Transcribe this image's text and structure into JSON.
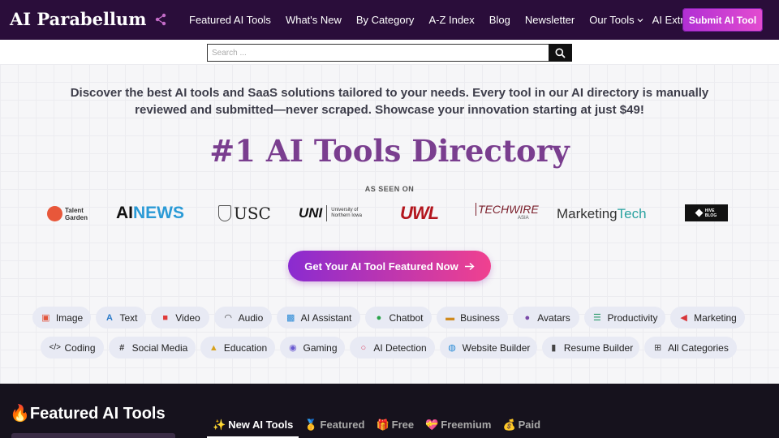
{
  "header": {
    "logo": "AI Parabellum",
    "nav": [
      {
        "label": "Featured AI Tools"
      },
      {
        "label": "What's New"
      },
      {
        "label": "By Category"
      },
      {
        "label": "A-Z Index"
      },
      {
        "label": "Blog"
      },
      {
        "label": "Newsletter"
      },
      {
        "label": "Our Tools"
      },
      {
        "label": "AI Extras"
      }
    ],
    "submit_label": "Submit AI Tool"
  },
  "search": {
    "placeholder": "Search ..."
  },
  "hero": {
    "tagline": "Discover the best AI tools and SaaS solutions tailored to your needs. Every tool in our AI directory is manually reviewed and submitted—never scraped. Showcase your innovation starting at just $49!",
    "title": "#1 AI Tools Directory",
    "seen_on": "AS SEEN ON",
    "logos": {
      "talent_top": "Talent",
      "talent_bottom": "Garden",
      "ainews_a": "AI",
      "ainews_b": "NEWS",
      "usc": "USC",
      "uni": "UNI",
      "uni_sub1": "University of",
      "uni_sub2": "Northern Iowa",
      "uwl": "UWL",
      "techwire": "TECHWIRE",
      "techwire_sub": "ASIA",
      "marketing_a": "Marketing",
      "marketing_b": "Tech",
      "hive_top": "HIVE",
      "hive_bottom": "BLOG"
    },
    "cta": "Get Your AI Tool Featured Now"
  },
  "categories": [
    {
      "label": "Image",
      "icon": "image-icon"
    },
    {
      "label": "Text",
      "icon": "text-icon"
    },
    {
      "label": "Video",
      "icon": "video-icon"
    },
    {
      "label": "Audio",
      "icon": "headphones-icon"
    },
    {
      "label": "AI Assistant",
      "icon": "robot-icon"
    },
    {
      "label": "Chatbot",
      "icon": "chat-icon"
    },
    {
      "label": "Business",
      "icon": "briefcase-icon"
    },
    {
      "label": "Avatars",
      "icon": "user-icon"
    },
    {
      "label": "Productivity",
      "icon": "list-icon"
    },
    {
      "label": "Marketing",
      "icon": "megaphone-icon"
    },
    {
      "label": "Coding",
      "icon": "code-icon"
    },
    {
      "label": "Social Media",
      "icon": "hashtag-icon"
    },
    {
      "label": "Education",
      "icon": "graduation-cap-icon"
    },
    {
      "label": "Gaming",
      "icon": "gamepad-icon"
    },
    {
      "label": "AI Detection",
      "icon": "magnifier-icon"
    },
    {
      "label": "Website Builder",
      "icon": "globe-icon"
    },
    {
      "label": "Resume Builder",
      "icon": "document-icon"
    },
    {
      "label": "All Categories",
      "icon": "grid-icon"
    }
  ],
  "featured": {
    "title": "Featured AI Tools",
    "title_emoji": "🔥",
    "tabs": [
      {
        "label": "New AI Tools",
        "emoji": "✨"
      },
      {
        "label": "Featured",
        "emoji": "🥇"
      },
      {
        "label": "Free",
        "emoji": "🎁"
      },
      {
        "label": "Freemium",
        "emoji": "💝"
      },
      {
        "label": "Paid",
        "emoji": "💰"
      }
    ]
  },
  "colors": {
    "navbar": "#2a0d3a",
    "accent_purple": "#7a3e8f",
    "cta_start": "#8a2bd0",
    "cta_end": "#f0418f",
    "chip_bg": "#e8eaf4",
    "dark_section": "#16121d"
  }
}
